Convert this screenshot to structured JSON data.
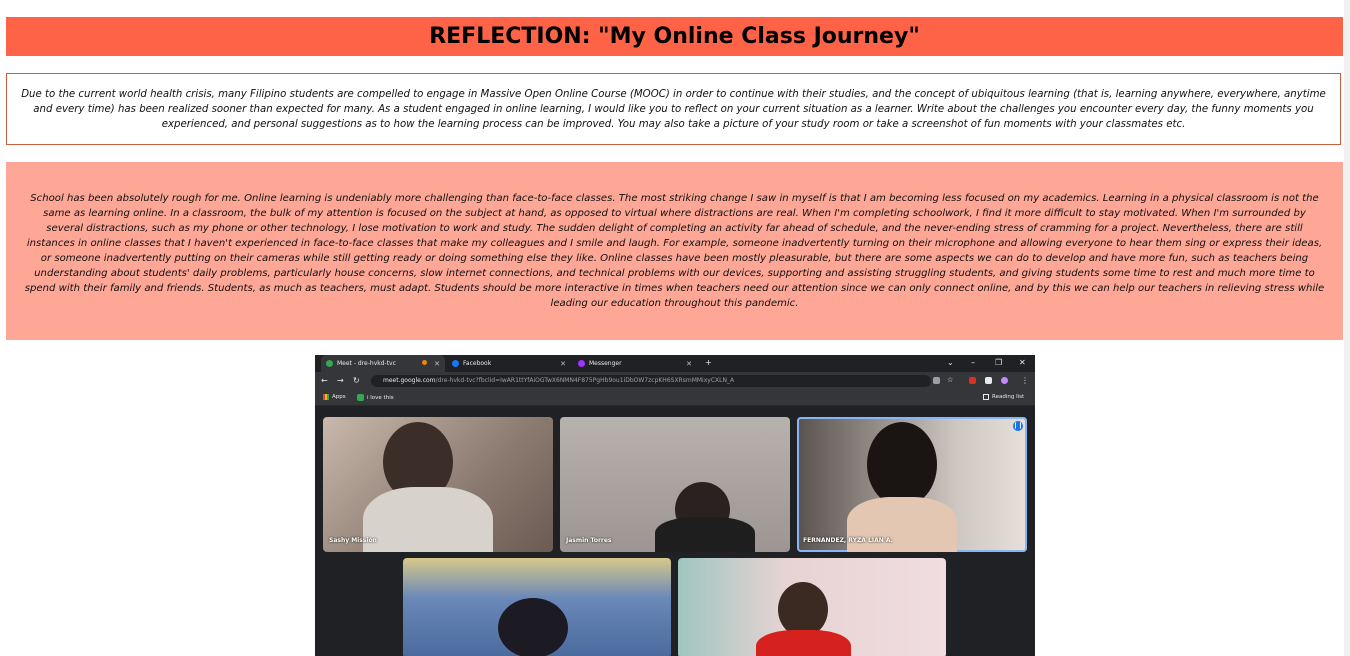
{
  "title": "REFLECTION: \"My Online Class Journey\"",
  "prompt": "Due to the current world health crisis, many Filipino students are compelled to engage in Massive Open Online Course (MOOC) in order to continue with their studies, and the concept of ubiquitous learning (that is, learning anywhere, everywhere, anytime and every time) has been realized sooner than expected for many. As a student engaged in online learning, I would like you to reflect on your current situation as a learner. Write about the challenges you encounter every day, the funny moments you experienced, and personal suggestions as to how the learning process can be improved. You may also take a picture of your study room or take a screenshot of fun moments with your classmates etc.",
  "answer": "School has been absolutely rough for me. Online learning is undeniably more challenging than face-to-face classes. The most striking change I saw in myself is that I am becoming less focused on my academics. Learning in a physical classroom is not the same as learning online. In a classroom, the bulk of my attention is focused on the subject at hand, as opposed to virtual where distractions are real. When I'm completing schoolwork, I find it more difficult to stay motivated. When I'm surrounded by several distractions, such as my phone or other technology, I lose motivation to work and study. The sudden delight of completing an activity far ahead of schedule, and the never-ending stress of cramming for a project. Nevertheless, there are still instances in online classes that I haven't experienced in face-to-face classes that make my colleagues and I smile and laugh. For example, someone inadvertently turning on their microphone and allowing everyone to hear them sing or express their ideas, or someone inadvertently putting on their cameras while still getting ready or doing something else they like. Online classes have been mostly pleasurable, but there are some aspects we can do to develop and have more fun, such as teachers being understanding about students' daily problems, particularly house concerns, slow internet connections, and technical problems with our devices, supporting and assisting struggling students, and giving students some time to rest and much more time to spend with their family and friends. Students, as much as teachers, must adapt. Students should be more interactive in times when teachers need our attention since we can only connect online, and by this we can help our teachers in relieving stress while leading our education throughout this pandemic.",
  "screenshot": {
    "tabs": [
      {
        "label": "Meet - dre-hvkd-tvc",
        "icon_color": "#34a853"
      },
      {
        "label": "Facebook",
        "icon_color": "#1877f2"
      },
      {
        "label": "Messenger",
        "icon_color": "#a033ff"
      }
    ],
    "new_tab": "+",
    "window_controls": {
      "minimize": "–",
      "maximize": "❐",
      "close": "✕",
      "chevron": "⌄"
    },
    "url_host": "meet.google.com",
    "url_rest": "/dre-hvkd-tvc?fbclid=IwAR1ttYfAiOGTwX6NMN4F875PgHb9ou1iDbOW7zcpKH6SXRsmMMixyCXLN_A",
    "bookmarks": {
      "apps": "Apps",
      "item": "i love this",
      "reading_list": "Reading list"
    },
    "participants": [
      {
        "name": "Sashy Mission"
      },
      {
        "name": "Jasmin Torres"
      },
      {
        "name": "FERNANDEZ, RYZA LIAN A."
      },
      {
        "name": ""
      },
      {
        "name": ""
      }
    ]
  }
}
